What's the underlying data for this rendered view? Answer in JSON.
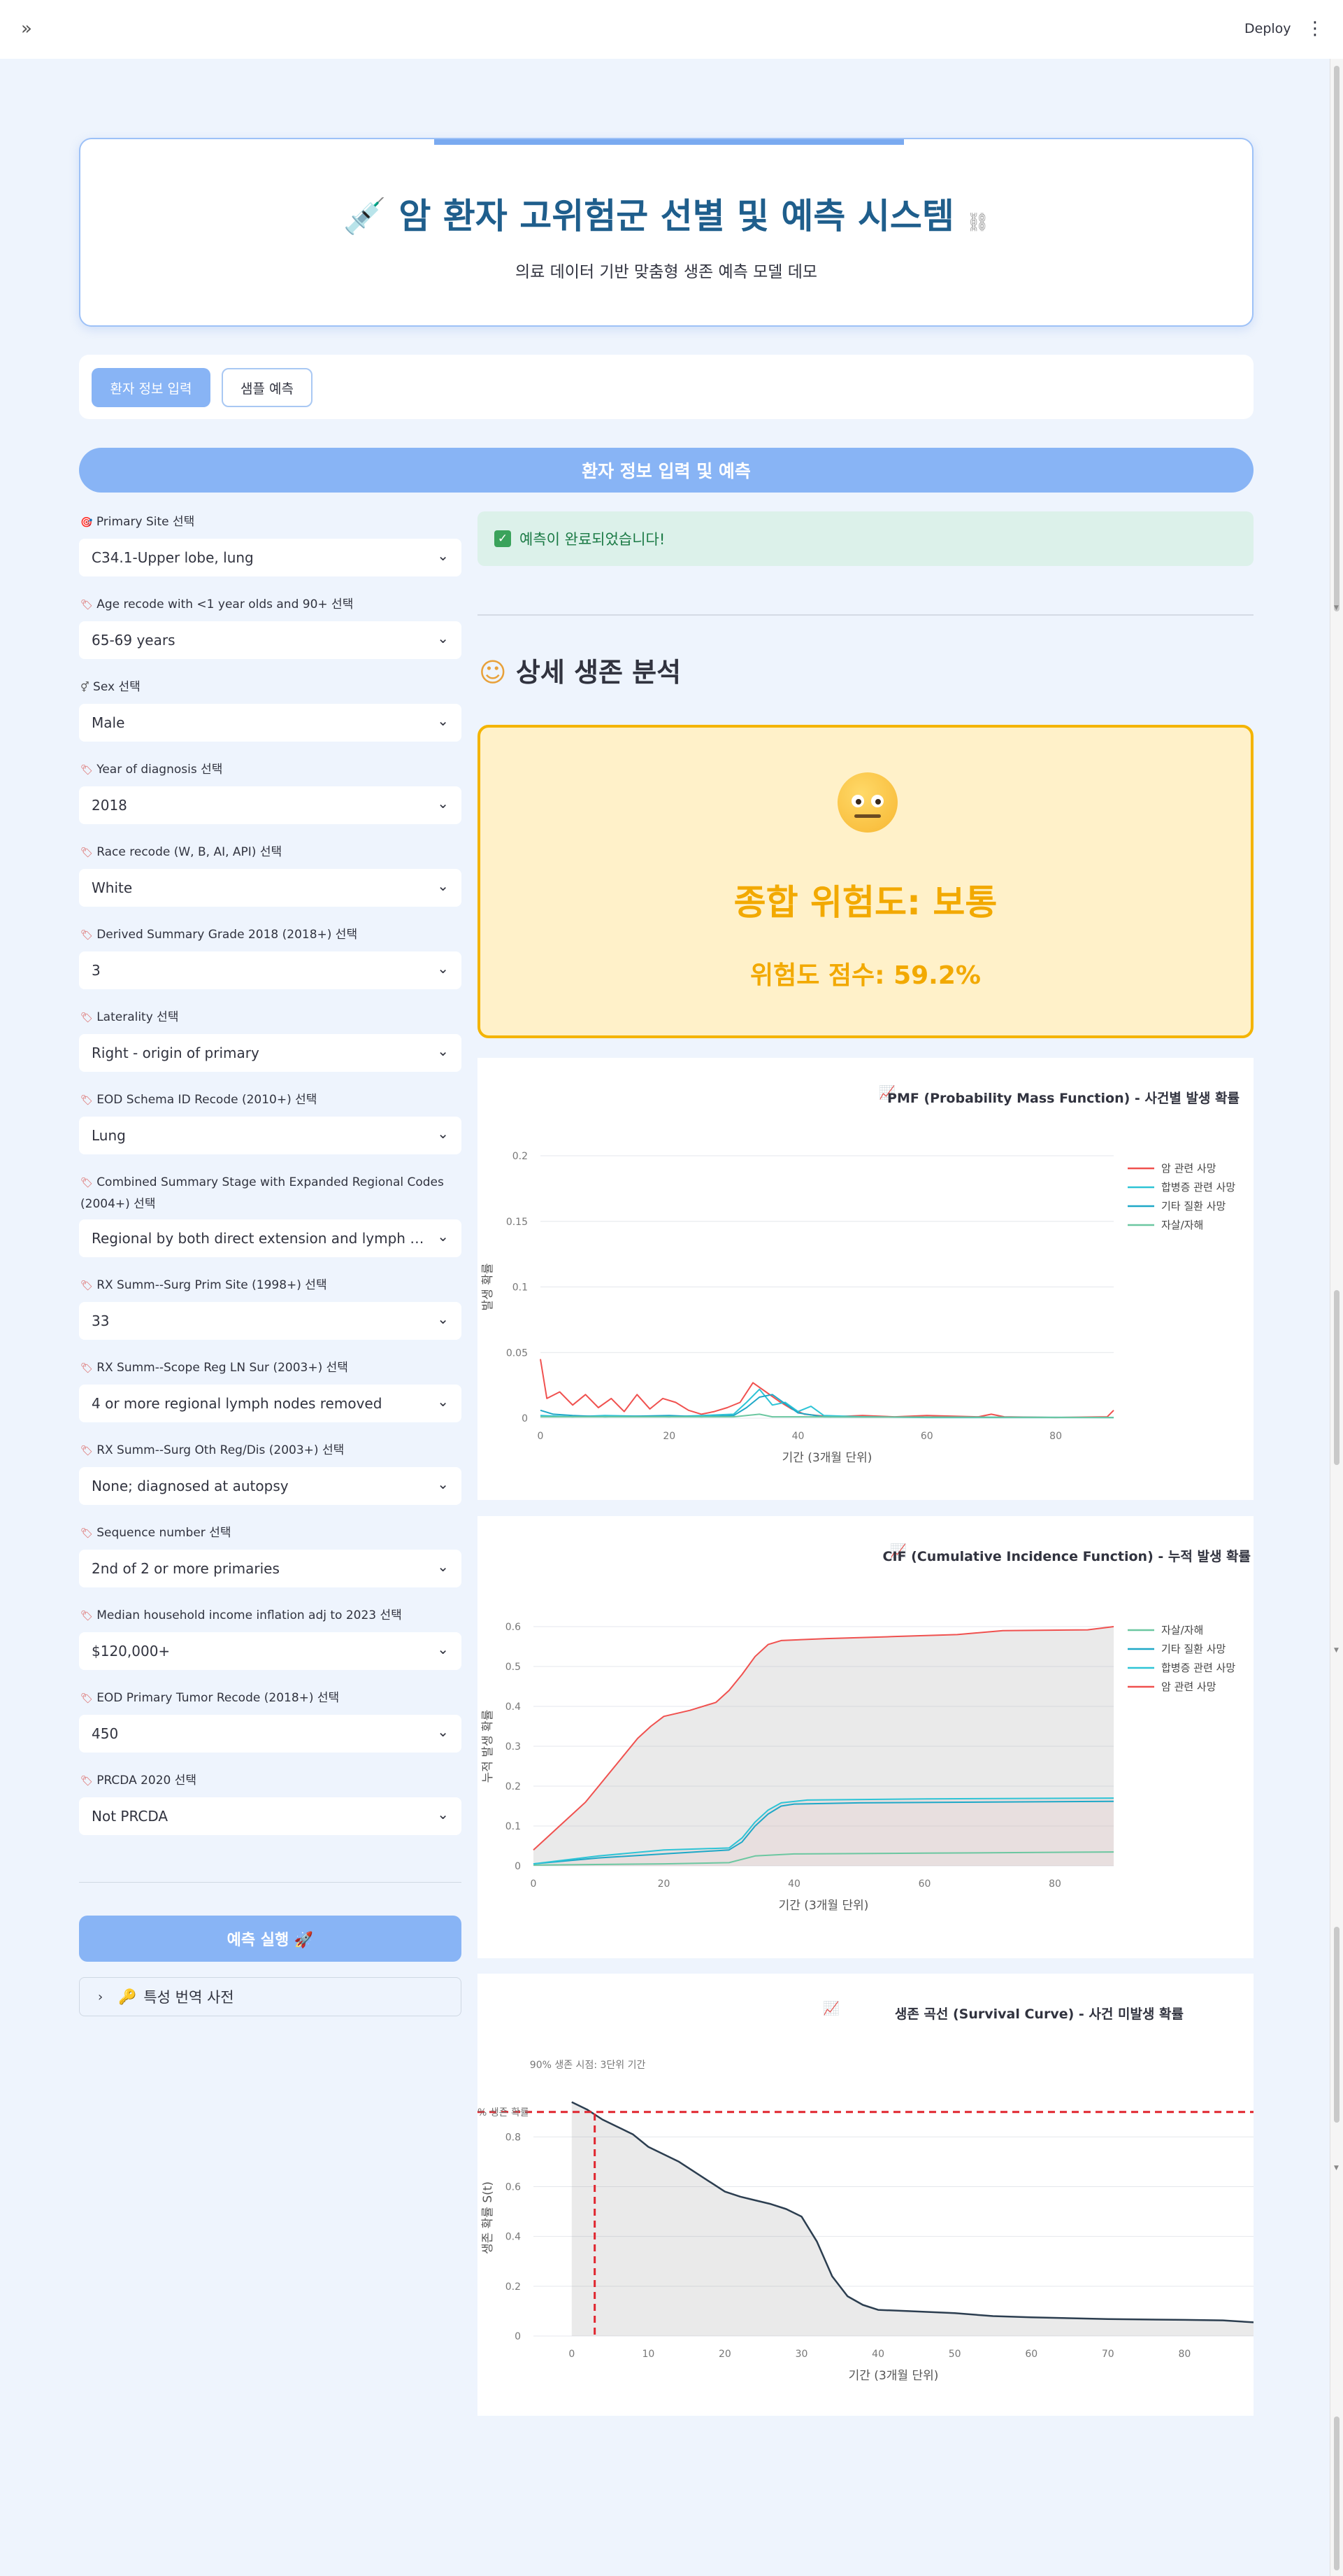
{
  "topbar": {
    "expand_icon": "double-chevron-right-icon",
    "deploy_label": "Deploy",
    "menu_icon": "kebab-icon"
  },
  "header": {
    "title": "암 환자 고위험군 선별 및 예측 시스템",
    "subtitle": "의료 데이터 기반 맞춤형 생존 예측 모델 데모"
  },
  "tabs": [
    {
      "label": "환자 정보 입력",
      "active": true
    },
    {
      "label": "샘플 예측",
      "active": false
    }
  ],
  "section_title": "환자 정보 입력 및 예측",
  "fields": [
    {
      "label": "Primary Site 선택",
      "value": "C34.1-Upper lobe, lung"
    },
    {
      "label": "Age recode with <1 year olds and 90+ 선택",
      "value": "65-69 years"
    },
    {
      "label": "Sex 선택",
      "value": "Male"
    },
    {
      "label": "Year of diagnosis 선택",
      "value": "2018"
    },
    {
      "label": "Race recode (W, B, AI, API) 선택",
      "value": "White"
    },
    {
      "label": "Derived Summary Grade 2018 (2018+) 선택",
      "value": "3"
    },
    {
      "label": "Laterality 선택",
      "value": "Right - origin of primary"
    },
    {
      "label": "EOD Schema ID Recode (2010+) 선택",
      "value": "Lung"
    },
    {
      "label": "Combined Summary Stage with Expanded Regional Codes (2004+) 선택",
      "value": "Regional by both direct extension and lymph nodes"
    },
    {
      "label": "RX Summ--Surg Prim Site (1998+) 선택",
      "value": "33"
    },
    {
      "label": "RX Summ--Scope Reg LN Sur (2003+) 선택",
      "value": "4 or more regional lymph nodes removed"
    },
    {
      "label": "RX Summ--Surg Oth Reg/Dis (2003+) 선택",
      "value": "None; diagnosed at autopsy"
    },
    {
      "label": "Sequence number 선택",
      "value": "2nd of 2 or more primaries"
    },
    {
      "label": "Median household income inflation adj to 2023 선택",
      "value": "$120,000+"
    },
    {
      "label": "EOD Primary Tumor Recode (2018+) 선택",
      "value": "450"
    },
    {
      "label": "PRCDA 2020 선택",
      "value": "Not PRCDA"
    }
  ],
  "run_button": "예측 실행 🚀",
  "expander": "특성 번역 사전",
  "success_message": "예측이 완료되었습니다!",
  "analysis_title": "상세 생존 분석",
  "risk": {
    "level_text": "종합 위험도: 보통",
    "score_text": "위험도 점수: 59.2%",
    "score": 59.2,
    "color": "#f2a900"
  },
  "chart_data": [
    {
      "type": "line",
      "title": "PMF (Probability Mass Function) - 사건별 발생 확률",
      "xlabel": "기간 (3개월 단위)",
      "ylabel": "발생 확률",
      "xlim": [
        0,
        89
      ],
      "ylim": [
        0,
        0.2
      ],
      "xticks": [
        0,
        20,
        40,
        60,
        80
      ],
      "yticks": [
        0,
        0.05,
        0.1,
        0.15,
        0.2
      ],
      "ytick_labels": [
        "0",
        "0.05",
        "0.1",
        "0.15",
        "0.2"
      ],
      "legend": "top-right",
      "series": [
        {
          "name": "암 관련 사망",
          "color": "#f0514f",
          "points": [
            [
              0,
              0.045
            ],
            [
              1,
              0.015
            ],
            [
              3,
              0.02
            ],
            [
              5,
              0.01
            ],
            [
              7,
              0.018
            ],
            [
              9,
              0.008
            ],
            [
              11,
              0.015
            ],
            [
              13,
              0.005
            ],
            [
              15,
              0.018
            ],
            [
              17,
              0.007
            ],
            [
              19,
              0.015
            ],
            [
              21,
              0.012
            ],
            [
              23,
              0.006
            ],
            [
              25,
              0.003
            ],
            [
              27,
              0.005
            ],
            [
              29,
              0.008
            ],
            [
              31,
              0.012
            ],
            [
              33,
              0.027
            ],
            [
              35,
              0.02
            ],
            [
              37,
              0.013
            ],
            [
              39,
              0.007
            ],
            [
              41,
              0.003
            ],
            [
              45,
              0.001
            ],
            [
              50,
              0.002
            ],
            [
              55,
              0.001
            ],
            [
              60,
              0.002
            ],
            [
              68,
              0.001
            ],
            [
              70,
              0.003
            ],
            [
              72,
              0.001
            ],
            [
              80,
              0.0005
            ],
            [
              88,
              0.001
            ],
            [
              89,
              0.006
            ]
          ]
        },
        {
          "name": "합병증 관련 사망",
          "color": "#2ec4d6",
          "points": [
            [
              0,
              0.002
            ],
            [
              5,
              0.001
            ],
            [
              10,
              0.002
            ],
            [
              20,
              0.001
            ],
            [
              25,
              0.002
            ],
            [
              30,
              0.003
            ],
            [
              32,
              0.012
            ],
            [
              34,
              0.022
            ],
            [
              36,
              0.01
            ],
            [
              38,
              0.012
            ],
            [
              40,
              0.005
            ],
            [
              42,
              0.009
            ],
            [
              44,
              0.002
            ],
            [
              50,
              0.001
            ],
            [
              60,
              0.0005
            ],
            [
              89,
              0.0005
            ]
          ]
        },
        {
          "name": "기타 질환 사망",
          "color": "#1fa8c7",
          "points": [
            [
              0,
              0.006
            ],
            [
              2,
              0.003
            ],
            [
              5,
              0.002
            ],
            [
              10,
              0.001
            ],
            [
              20,
              0.002
            ],
            [
              25,
              0.001
            ],
            [
              30,
              0.002
            ],
            [
              32,
              0.008
            ],
            [
              34,
              0.016
            ],
            [
              36,
              0.018
            ],
            [
              38,
              0.011
            ],
            [
              40,
              0.004
            ],
            [
              44,
              0.001
            ],
            [
              89,
              0.0005
            ]
          ]
        },
        {
          "name": "자살/자해",
          "color": "#6cc7a1",
          "points": [
            [
              0,
              0.001
            ],
            [
              10,
              0.001
            ],
            [
              30,
              0.001
            ],
            [
              34,
              0.003
            ],
            [
              36,
              0.001
            ],
            [
              89,
              0.0005
            ]
          ]
        }
      ]
    },
    {
      "type": "area",
      "title": "CIF (Cumulative Incidence Function) - 누적 발생 확률",
      "xlabel": "기간 (3개월 단위)",
      "ylabel": "누적 발생 확률",
      "xlim": [
        0,
        89
      ],
      "ylim": [
        0,
        0.6
      ],
      "xticks": [
        0,
        20,
        40,
        60,
        80
      ],
      "yticks": [
        0,
        0.1,
        0.2,
        0.3,
        0.4,
        0.5,
        0.6
      ],
      "ytick_labels": [
        "0",
        "0.1",
        "0.2",
        "0.3",
        "0.4",
        "0.5",
        "0.6"
      ],
      "legend": "top-right",
      "series": [
        {
          "name": "자살/자해",
          "color": "#6cc7a1",
          "points": [
            [
              0,
              0.002
            ],
            [
              20,
              0.005
            ],
            [
              30,
              0.008
            ],
            [
              34,
              0.025
            ],
            [
              40,
              0.03
            ],
            [
              60,
              0.032
            ],
            [
              89,
              0.035
            ]
          ]
        },
        {
          "name": "기타 질환 사망",
          "color": "#1fa8c7",
          "points": [
            [
              0,
              0.005
            ],
            [
              10,
              0.02
            ],
            [
              20,
              0.03
            ],
            [
              30,
              0.04
            ],
            [
              32,
              0.06
            ],
            [
              34,
              0.1
            ],
            [
              36,
              0.13
            ],
            [
              38,
              0.15
            ],
            [
              40,
              0.155
            ],
            [
              50,
              0.158
            ],
            [
              70,
              0.16
            ],
            [
              89,
              0.162
            ]
          ]
        },
        {
          "name": "합병증 관련 사망",
          "color": "#2ec4d6",
          "points": [
            [
              0,
              0.005
            ],
            [
              10,
              0.025
            ],
            [
              20,
              0.04
            ],
            [
              30,
              0.045
            ],
            [
              32,
              0.07
            ],
            [
              34,
              0.11
            ],
            [
              36,
              0.14
            ],
            [
              38,
              0.158
            ],
            [
              42,
              0.165
            ],
            [
              60,
              0.168
            ],
            [
              89,
              0.17
            ]
          ]
        },
        {
          "name": "암 관련 사망",
          "color": "#f0514f",
          "points": [
            [
              0,
              0.04
            ],
            [
              2,
              0.07
            ],
            [
              4,
              0.1
            ],
            [
              6,
              0.13
            ],
            [
              8,
              0.16
            ],
            [
              10,
              0.2
            ],
            [
              12,
              0.24
            ],
            [
              14,
              0.28
            ],
            [
              16,
              0.32
            ],
            [
              18,
              0.35
            ],
            [
              20,
              0.375
            ],
            [
              24,
              0.39
            ],
            [
              28,
              0.41
            ],
            [
              30,
              0.44
            ],
            [
              32,
              0.48
            ],
            [
              34,
              0.525
            ],
            [
              36,
              0.555
            ],
            [
              38,
              0.565
            ],
            [
              45,
              0.57
            ],
            [
              55,
              0.575
            ],
            [
              65,
              0.58
            ],
            [
              72,
              0.59
            ],
            [
              85,
              0.592
            ],
            [
              89,
              0.6
            ]
          ]
        }
      ]
    },
    {
      "type": "line",
      "title": "생존 곡선 (Survival Curve) - 사건 미발생 확률",
      "xlabel": "기간 (3개월 단위)",
      "ylabel": "생존 확률 S(t)",
      "xlim": [
        -5,
        89
      ],
      "ylim": [
        0,
        0.95
      ],
      "xticks": [
        0,
        10,
        20,
        30,
        40,
        50,
        60,
        70,
        80
      ],
      "yticks": [
        0,
        0.2,
        0.4,
        0.6,
        0.8
      ],
      "ytick_labels": [
        "0",
        "0.2",
        "0.4",
        "0.6",
        "0.8"
      ],
      "reference_y": 0.9,
      "reference_y_label": "% 생존 확률",
      "reference_x": 3,
      "reference_x_label": "90% 생존 시점: 3단위 기간",
      "series": [
        {
          "name": "생존 확률",
          "color": "#2c3e50",
          "points": [
            [
              0,
              0.94
            ],
            [
              2,
              0.91
            ],
            [
              4,
              0.87
            ],
            [
              6,
              0.84
            ],
            [
              8,
              0.81
            ],
            [
              10,
              0.76
            ],
            [
              12,
              0.73
            ],
            [
              14,
              0.7
            ],
            [
              16,
              0.66
            ],
            [
              18,
              0.62
            ],
            [
              20,
              0.58
            ],
            [
              22,
              0.56
            ],
            [
              24,
              0.545
            ],
            [
              26,
              0.53
            ],
            [
              28,
              0.51
            ],
            [
              30,
              0.48
            ],
            [
              32,
              0.38
            ],
            [
              34,
              0.24
            ],
            [
              36,
              0.16
            ],
            [
              38,
              0.125
            ],
            [
              40,
              0.105
            ],
            [
              44,
              0.1
            ],
            [
              50,
              0.092
            ],
            [
              55,
              0.08
            ],
            [
              60,
              0.075
            ],
            [
              70,
              0.068
            ],
            [
              80,
              0.065
            ],
            [
              85,
              0.063
            ],
            [
              89,
              0.055
            ]
          ]
        }
      ]
    }
  ]
}
